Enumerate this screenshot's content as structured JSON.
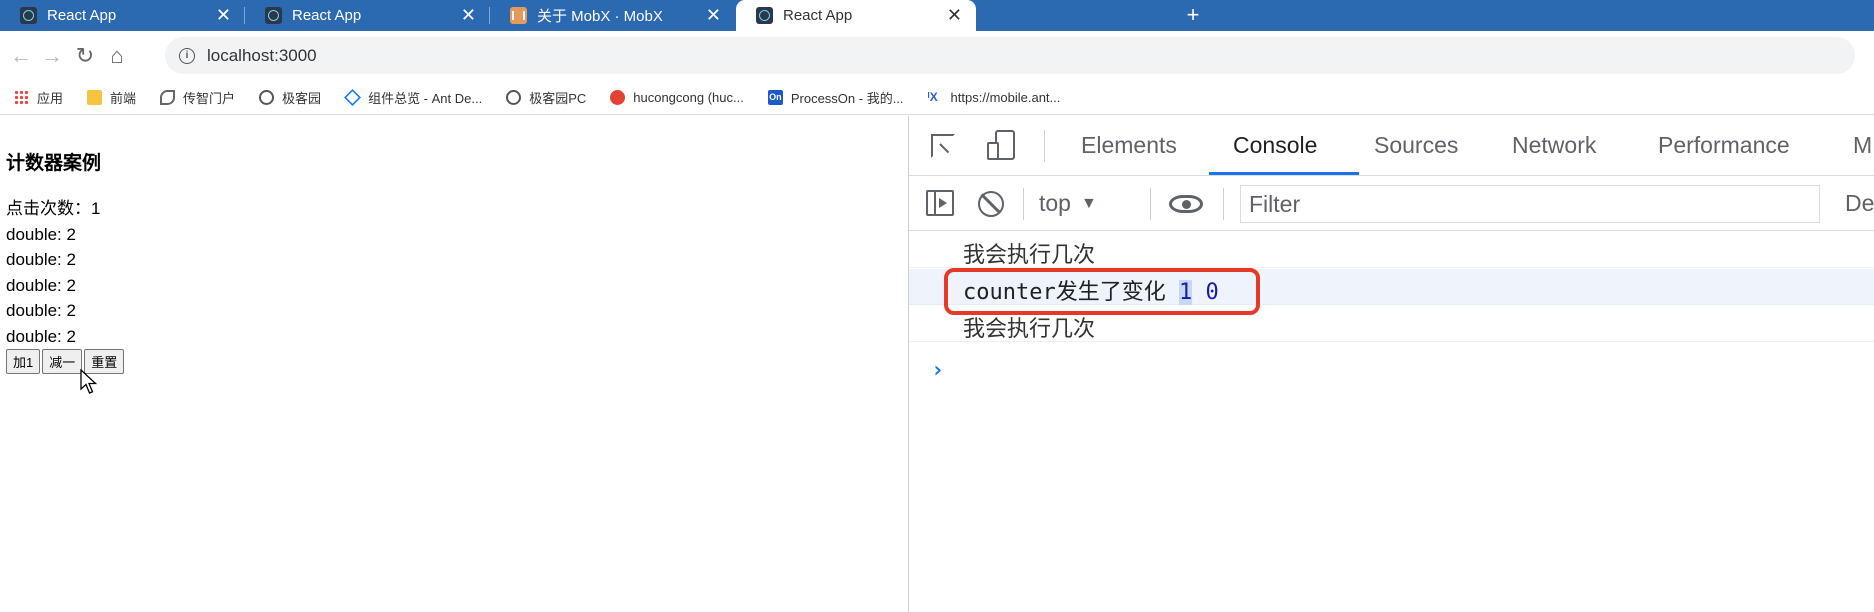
{
  "browser": {
    "tabs": [
      {
        "title": "React App",
        "icon": "react-icon"
      },
      {
        "title": "React App",
        "icon": "react-icon"
      },
      {
        "title": "关于 MobX · MobX",
        "icon": "mobx-icon"
      },
      {
        "title": "React App",
        "icon": "react-icon",
        "active": true
      }
    ],
    "tab_close": "✕",
    "new_tab": "+",
    "nav": {
      "back": "←",
      "forward": "→",
      "reload": "↻",
      "home": "⌂"
    },
    "info_glyph": "i",
    "url": "localhost:3000",
    "bookmarks": [
      {
        "label": "应用",
        "icon": "apps-grid-icon"
      },
      {
        "label": "前端",
        "icon": "folder-icon"
      },
      {
        "label": "传智门户",
        "icon": "swirl-icon"
      },
      {
        "label": "极客园",
        "icon": "circle-icon"
      },
      {
        "label": "组件总览 - Ant De...",
        "icon": "ant-design-icon"
      },
      {
        "label": "极客园PC",
        "icon": "circle-icon"
      },
      {
        "label": "hucongcong (huc...",
        "icon": "gitee-icon"
      },
      {
        "label": "ProcessOn - 我的...",
        "icon": "processon-icon"
      },
      {
        "label": "https://mobile.ant...",
        "icon": "ant-mobile-icon"
      }
    ],
    "processon_badge": "On",
    "antmobile_badge": "ᴵX"
  },
  "page": {
    "title": "计数器案例",
    "count_line": "点击次数：1",
    "double_lines": [
      "double: 2",
      "double: 2",
      "double: 2",
      "double: 2",
      "double: 2"
    ],
    "buttons": {
      "add": "加1",
      "sub": "减一",
      "reset": "重置"
    }
  },
  "devtools": {
    "tabs": [
      "Elements",
      "Console",
      "Sources",
      "Network",
      "Performance",
      "M"
    ],
    "active_tab": "Console",
    "context": "top",
    "context_caret": "▼",
    "filter_placeholder": "Filter",
    "levels": "De",
    "messages": {
      "first": "我会执行几次",
      "second_text": "counter发生了变化",
      "second_num1": "1",
      "second_num2": "0",
      "third": "我会执行几次"
    },
    "prompt": "›"
  },
  "colors": {
    "tab_strip": "#2b69b0",
    "devtools_accent": "#1a73e8",
    "highlight_box": "#e53a2a"
  }
}
